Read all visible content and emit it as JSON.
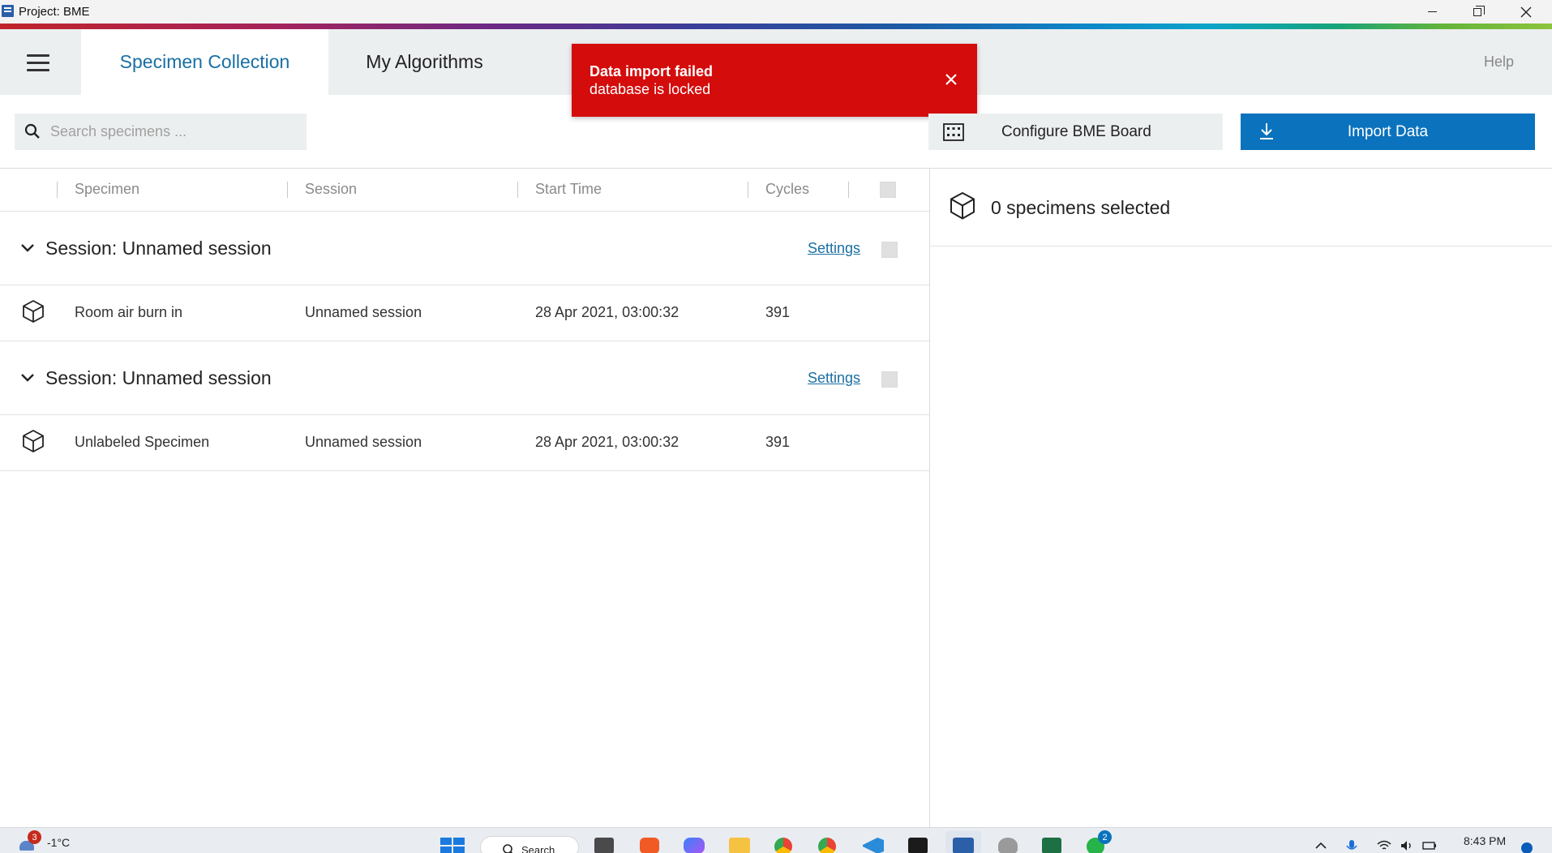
{
  "window": {
    "title": "Project: BME"
  },
  "header": {
    "tabs": [
      {
        "label": "Specimen Collection",
        "active": true
      },
      {
        "label": "My Algorithms",
        "active": false
      }
    ],
    "help_label": "Help"
  },
  "toast": {
    "title": "Data import failed",
    "message": "database is locked",
    "close_glyph": "✕"
  },
  "toolbar": {
    "search_placeholder": "Search specimens ...",
    "search_value": "",
    "configure_label": "Configure BME Board",
    "import_label": "Import Data"
  },
  "table": {
    "columns": [
      "Specimen",
      "Session",
      "Start Time",
      "Cycles"
    ],
    "groups": [
      {
        "title": "Session: Unnamed session",
        "settings_label": "Settings",
        "rows": [
          {
            "specimen": "Room air burn in",
            "session": "Unnamed session",
            "start_time": "28 Apr 2021, 03:00:32",
            "cycles": "391"
          }
        ]
      },
      {
        "title": "Session: Unnamed session",
        "settings_label": "Settings",
        "rows": [
          {
            "specimen": "Unlabeled Specimen",
            "session": "Unnamed session",
            "start_time": "28 Apr 2021, 03:00:32",
            "cycles": "391"
          }
        ]
      }
    ]
  },
  "selection": {
    "summary": "0 specimens selected"
  },
  "taskbar": {
    "weather_temp": "-1°C",
    "weather_badge": "3",
    "search_label": "Search",
    "whatsapp_badge": "2",
    "clock": "8:43 PM"
  },
  "colors": {
    "accent_blue": "#0b72bd",
    "tab_active_text": "#1a6fa3",
    "toast_red": "#d40c0c",
    "header_bg": "#eceff0"
  }
}
